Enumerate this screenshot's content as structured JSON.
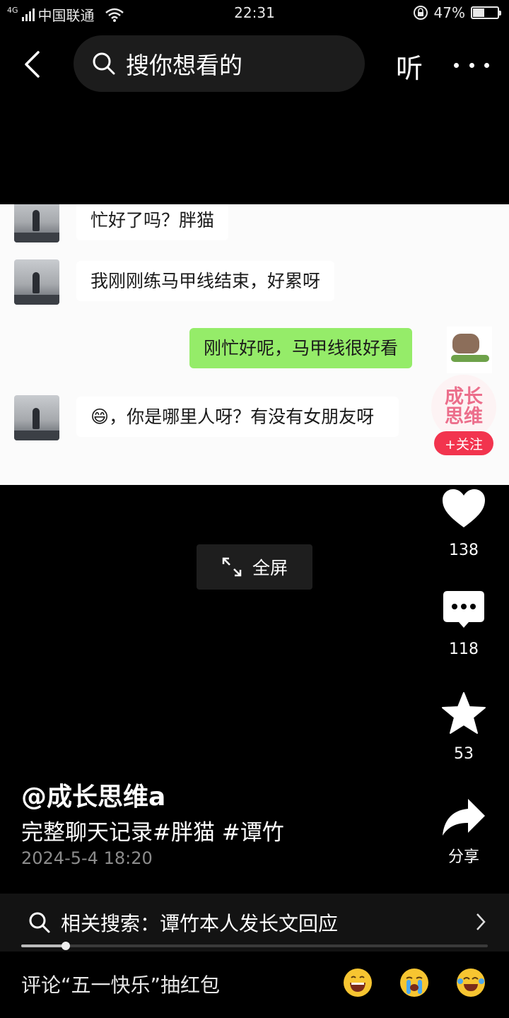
{
  "status_bar": {
    "network": "4G",
    "carrier": "中国联通",
    "time": "22:31",
    "battery_percent_label": "47%",
    "battery_level": 0.47
  },
  "top_nav": {
    "search_placeholder": "搜你想看的",
    "listen_label": "听"
  },
  "video": {
    "messages": [
      {
        "side": "left",
        "text": "忙好了吗？胖猫"
      },
      {
        "side": "left",
        "text": "我刚刚练马甲线结束，好累呀"
      },
      {
        "side": "right",
        "text": "刚忙好呢，马甲线很好看"
      },
      {
        "side": "left",
        "emoji": "😄",
        "text": "，你是哪里人呀？有没有女朋友呀"
      }
    ],
    "creator_avatar_text": [
      "成长",
      "思维"
    ],
    "follow_label": "+关注",
    "fullscreen_label": "全屏"
  },
  "actions": {
    "like_count": "138",
    "comment_count": "118",
    "favorite_count": "53",
    "share_label": "分享"
  },
  "post": {
    "author": "@成长思维a",
    "caption": "完整聊天记录#胖猫 #谭竹",
    "date": "2024-5-4 18:20"
  },
  "related_search": {
    "label": "相关搜索：谭竹本人发长文回应"
  },
  "playback": {
    "progress": 0.095
  },
  "comment_bar": {
    "placeholder": "评论“五一快乐”抽红包",
    "quick_emojis": [
      "laughing-face",
      "crying-face",
      "tearful-joy-face"
    ]
  },
  "colors": {
    "follow_red": "#f2344e",
    "my_bubble_green": "#95ec69",
    "avatar_pink": "#ec6e8b"
  }
}
